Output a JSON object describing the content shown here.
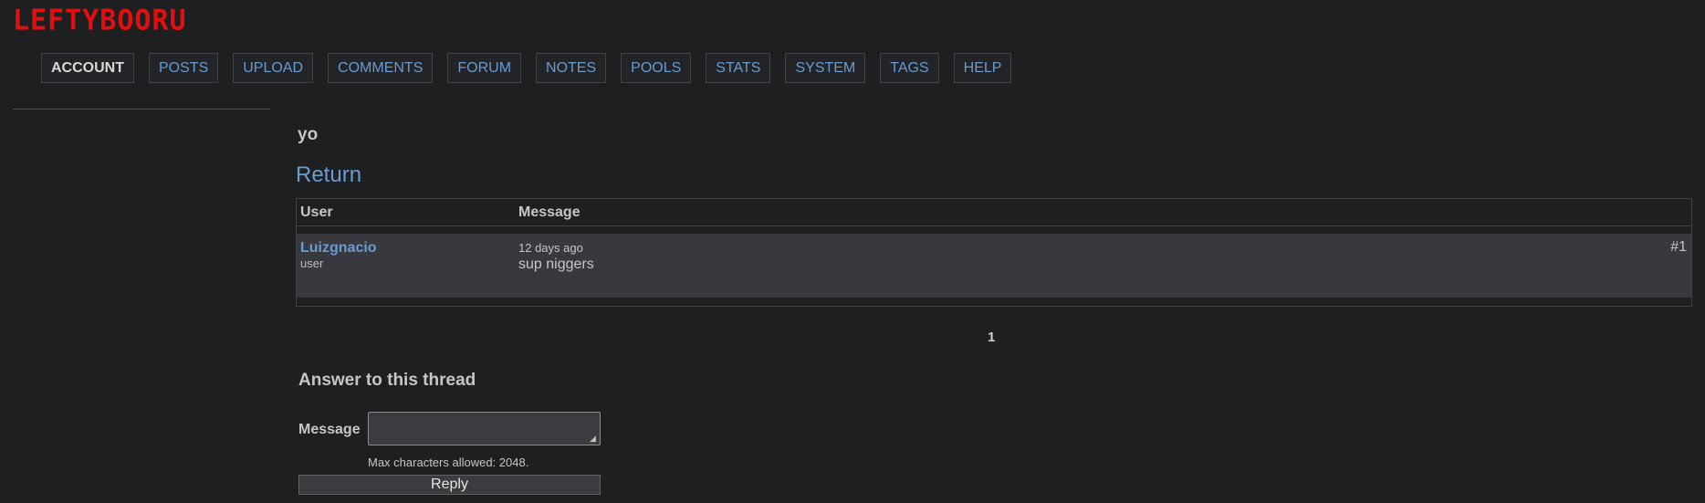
{
  "site": {
    "logo": "LEFTYBOORU"
  },
  "nav": {
    "items": [
      {
        "label": "ACCOUNT",
        "active": true
      },
      {
        "label": "POSTS"
      },
      {
        "label": "UPLOAD"
      },
      {
        "label": "COMMENTS"
      },
      {
        "label": "FORUM"
      },
      {
        "label": "NOTES"
      },
      {
        "label": "POOLS"
      },
      {
        "label": "STATS"
      },
      {
        "label": "SYSTEM"
      },
      {
        "label": "TAGS"
      },
      {
        "label": "HELP"
      }
    ]
  },
  "thread": {
    "title": "yo",
    "return_label": "Return",
    "columns": {
      "user": "User",
      "message": "Message"
    },
    "posts": [
      {
        "author": "Luizgnacio",
        "role": "user",
        "date": "12 days ago",
        "body": "sup niggers",
        "number": "#1"
      }
    ],
    "page": "1"
  },
  "reply_form": {
    "heading": "Answer to this thread",
    "message_label": "Message",
    "message_value": "",
    "max_chars_note": "Max characters allowed: 2048.",
    "submit_label": "Reply"
  },
  "colors": {
    "background": "#1e1f21",
    "link": "#6a9bd1",
    "logo": "#e01010",
    "row_bg": "#37393e"
  },
  "icons": {
    "resize": "resize-handle-icon"
  }
}
